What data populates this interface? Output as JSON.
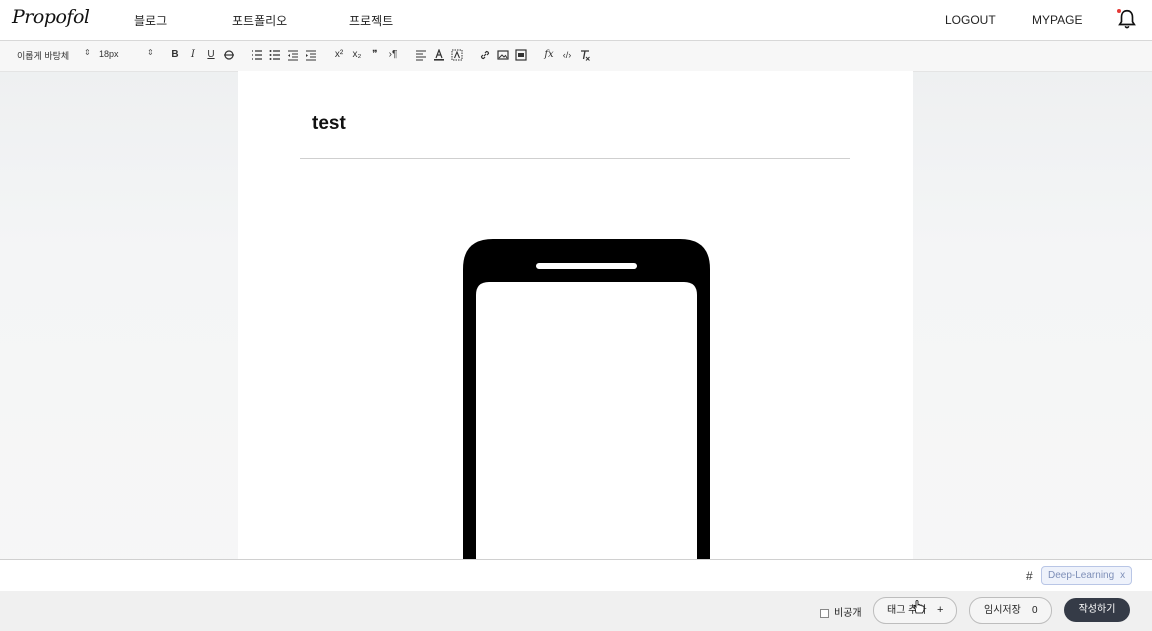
{
  "nav": {
    "logo": "Propofol",
    "links": [
      "블로그",
      "포트폴리오",
      "프로젝트"
    ],
    "logout": "LOGOUT",
    "mypage": "MYPAGE",
    "bell_icon": "bell-icon"
  },
  "toolbar": {
    "font": "이롭게 바탕체",
    "size": "18px",
    "superscript": "x²",
    "subscript": "x₂",
    "quote": "❞",
    "rtl": "›¶",
    "formula": "fx",
    "code": "‹/›"
  },
  "editor": {
    "title": "test"
  },
  "tagbar": {
    "hash": "#",
    "tags": [
      {
        "label": "Deep-Learning",
        "remove": "x"
      }
    ]
  },
  "footer": {
    "private_label": "비공개",
    "add_tag_label": "태그 추가",
    "add_tag_plus": "+",
    "temp_save_label": "임시저장",
    "temp_save_count": "0",
    "submit_label": "작성하기"
  }
}
